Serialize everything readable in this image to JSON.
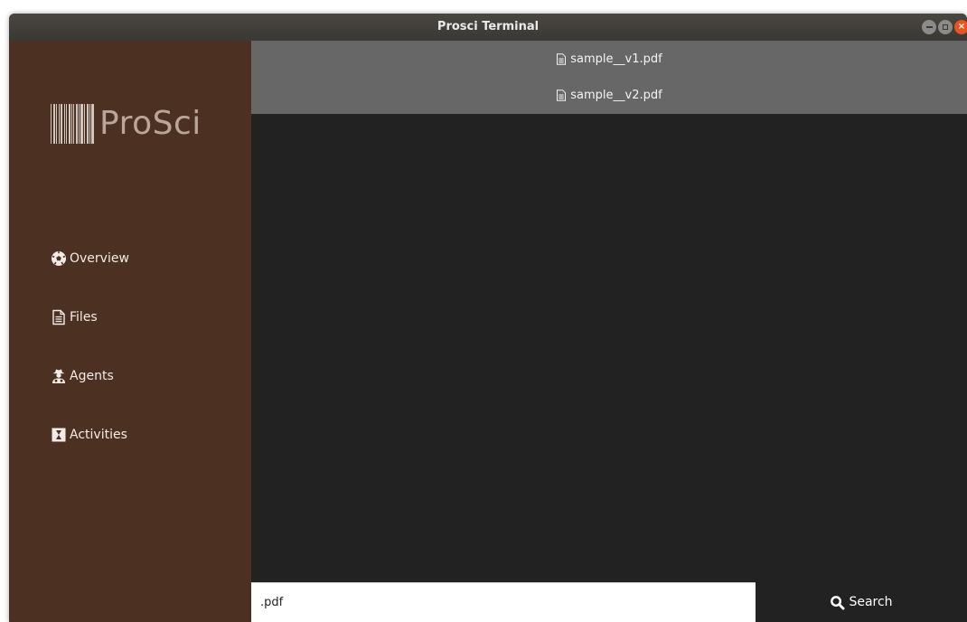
{
  "window": {
    "title": "Prosci Terminal"
  },
  "brand": {
    "logo_text": "ProSci"
  },
  "sidebar": {
    "items": [
      {
        "label": "Overview",
        "icon": "soccer-ball-icon"
      },
      {
        "label": "Files",
        "icon": "file-text-icon"
      },
      {
        "label": "Agents",
        "icon": "user-secret-icon"
      },
      {
        "label": "Activities",
        "icon": "hourglass-icon"
      }
    ]
  },
  "results": {
    "files": [
      {
        "name": "sample__v1.pdf",
        "icon": "file-text-icon"
      },
      {
        "name": "sample__v2.pdf",
        "icon": "file-text-icon"
      }
    ]
  },
  "search": {
    "value": ".pdf",
    "button_label": "Search",
    "icon": "search-icon"
  },
  "colors": {
    "sidebar": "#4c3022",
    "results_bg": "#676767",
    "main_bg": "#222222",
    "close_button": "#e95420"
  }
}
